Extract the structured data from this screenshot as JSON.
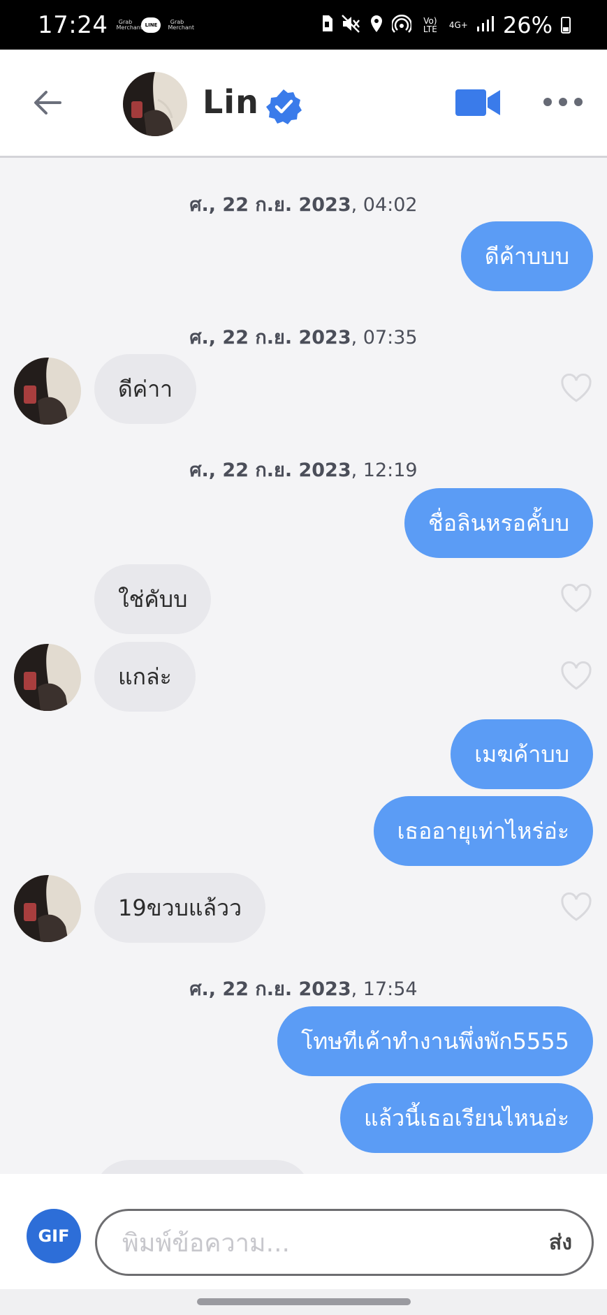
{
  "status_bar": {
    "time": "17:24",
    "apps": [
      "Grab Merchant",
      "LINE",
      "Grab Merchant"
    ],
    "network": "Vo) LTE",
    "data": "4G+",
    "battery": "26%"
  },
  "header": {
    "contact_name": "Lin",
    "verified": true
  },
  "messages": [
    {
      "type": "timestamp",
      "date": "ศ., 22 ก.ย. 2023",
      "time": ", 04:02"
    },
    {
      "type": "outgoing",
      "text": "ดีค้าบบบ"
    },
    {
      "type": "timestamp",
      "date": "ศ., 22 ก.ย. 2023",
      "time": ", 07:35"
    },
    {
      "type": "incoming",
      "text": "ดีค่าา"
    },
    {
      "type": "timestamp",
      "date": "ศ., 22 ก.ย. 2023",
      "time": ", 12:19"
    },
    {
      "type": "outgoing",
      "text": "ชื่อลินหรอคั้บบ"
    },
    {
      "type": "incoming",
      "text": "ใช่คับบ"
    },
    {
      "type": "incoming",
      "text": "แกล่ะ"
    },
    {
      "type": "outgoing",
      "text": "เมฆค้าบบ"
    },
    {
      "type": "outgoing",
      "text": "เธออายุเท่าไหร่อ่ะ"
    },
    {
      "type": "incoming",
      "text": "19ขวบแล้วว"
    },
    {
      "type": "timestamp",
      "date": "ศ., 22 ก.ย. 2023",
      "time": ", 17:54"
    },
    {
      "type": "outgoing",
      "text": "โทษทีเค้าทำงานพึ่งพัก5555"
    },
    {
      "type": "outgoing",
      "text": "แล้วนี้เธอเรียนไหนอ่ะ"
    }
  ],
  "composer": {
    "gif_label": "GIF",
    "placeholder": "พิมพ์ข้อความ...",
    "send_label": "ส่ง"
  },
  "colors": {
    "outgoing_bubble": "#5b9cf5",
    "incoming_bubble": "#e8e8ec",
    "accent": "#3a7bea",
    "gif_button": "#2d6ed8"
  },
  "icons": [
    "back-arrow-icon",
    "verified-badge-icon",
    "video-call-icon",
    "more-options-icon",
    "heart-icon"
  ]
}
